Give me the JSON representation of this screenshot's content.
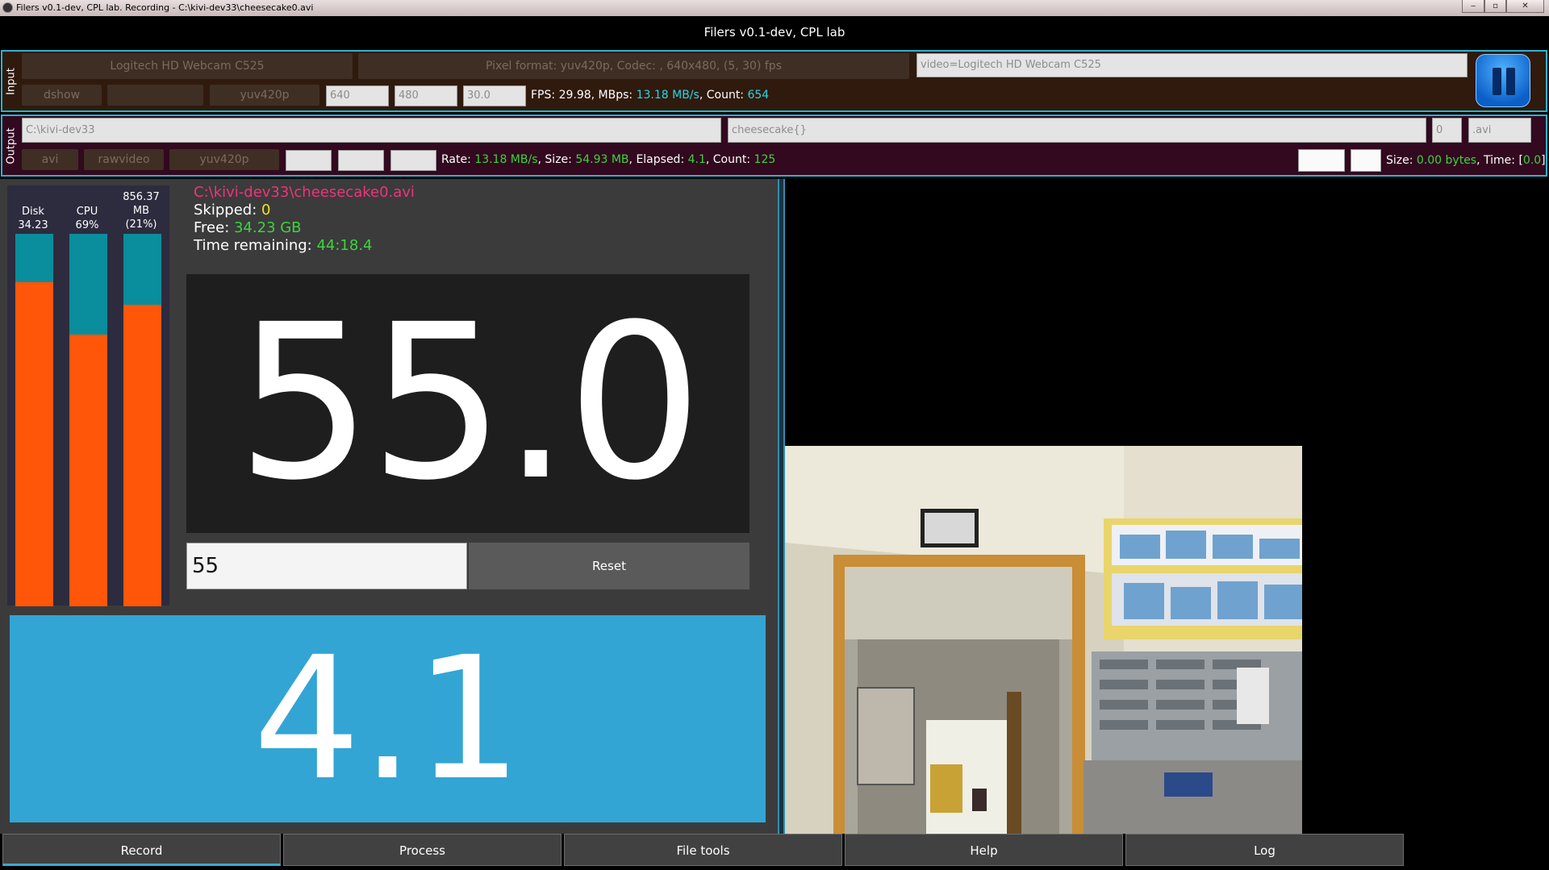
{
  "window": {
    "os_title": "Filers v0.1-dev, CPL lab. Recording - C:\\kivi-dev33\\cheesecake0.avi",
    "app_title": "Filers v0.1-dev, CPL lab"
  },
  "input": {
    "section_label": "Input",
    "device_button": "Logitech HD Webcam C525",
    "format_info": "Pixel format: yuv420p, Codec: , 640x480, (5, 30) fps",
    "device_string": "video=Logitech HD Webcam C525",
    "source_format": "dshow",
    "blank_option": "",
    "pixel_format": "yuv420p",
    "width": "640",
    "height": "480",
    "rate": "30.0",
    "stats": {
      "fps_label": "FPS: ",
      "fps": "29.98",
      "mbps_label": ", MBps: ",
      "mbps": "13.18 MB/s",
      "count_label": ", Count: ",
      "count": "654"
    }
  },
  "output": {
    "section_label": "Output",
    "path": "C:\\kivi-dev33",
    "filename": "cheesecake{}",
    "index": "0",
    "extension": ".avi",
    "format": "avi",
    "codec": "rawvideo",
    "pixel_format": "yuv420p",
    "stats": {
      "rate_label": "Rate: ",
      "rate": "13.18 MB/s",
      "size_label": ", Size: ",
      "size": "54.93 MB",
      "elapsed_label": ", Elapsed: ",
      "elapsed": "4.1",
      "count_label": ", Count: ",
      "count": "125"
    },
    "right_stats": {
      "size_label": "Size: ",
      "size": "0.00 bytes",
      "time_label": ", Time: [",
      "time": "0.0",
      "time_close": "]"
    }
  },
  "meters": [
    {
      "label": "Disk\n34.23 GB",
      "level": 0.87
    },
    {
      "label": "CPU\n69%",
      "level": 0.73
    },
    {
      "label": "856.37\nMB\n(21%)",
      "level": 0.81
    }
  ],
  "recording": {
    "file": "C:\\kivi-dev33\\cheesecake0.avi",
    "skipped_label": "Skipped: ",
    "skipped": "0",
    "free_label": "Free: ",
    "free": "34.23 GB",
    "remaining_label": "Time remaining: ",
    "remaining": "44:18.4"
  },
  "timer": {
    "display": "55.0",
    "input_value": "55",
    "reset_label": "Reset",
    "elapsed_display": "4.1"
  },
  "tabs": [
    {
      "label": "Record",
      "active": true
    },
    {
      "label": "Process",
      "active": false
    },
    {
      "label": "File tools",
      "active": false
    },
    {
      "label": "Help",
      "active": false
    },
    {
      "label": "Log",
      "active": false
    }
  ],
  "colors": {
    "accent_blue": "#32a5d4",
    "meter_fill": "#ff5609",
    "meter_track": "#0a8d9c",
    "stat_cyan": "#29d6e6",
    "stat_green": "#3cd43c",
    "stat_yellow": "#f0e020",
    "file_pink": "#f0337a"
  }
}
